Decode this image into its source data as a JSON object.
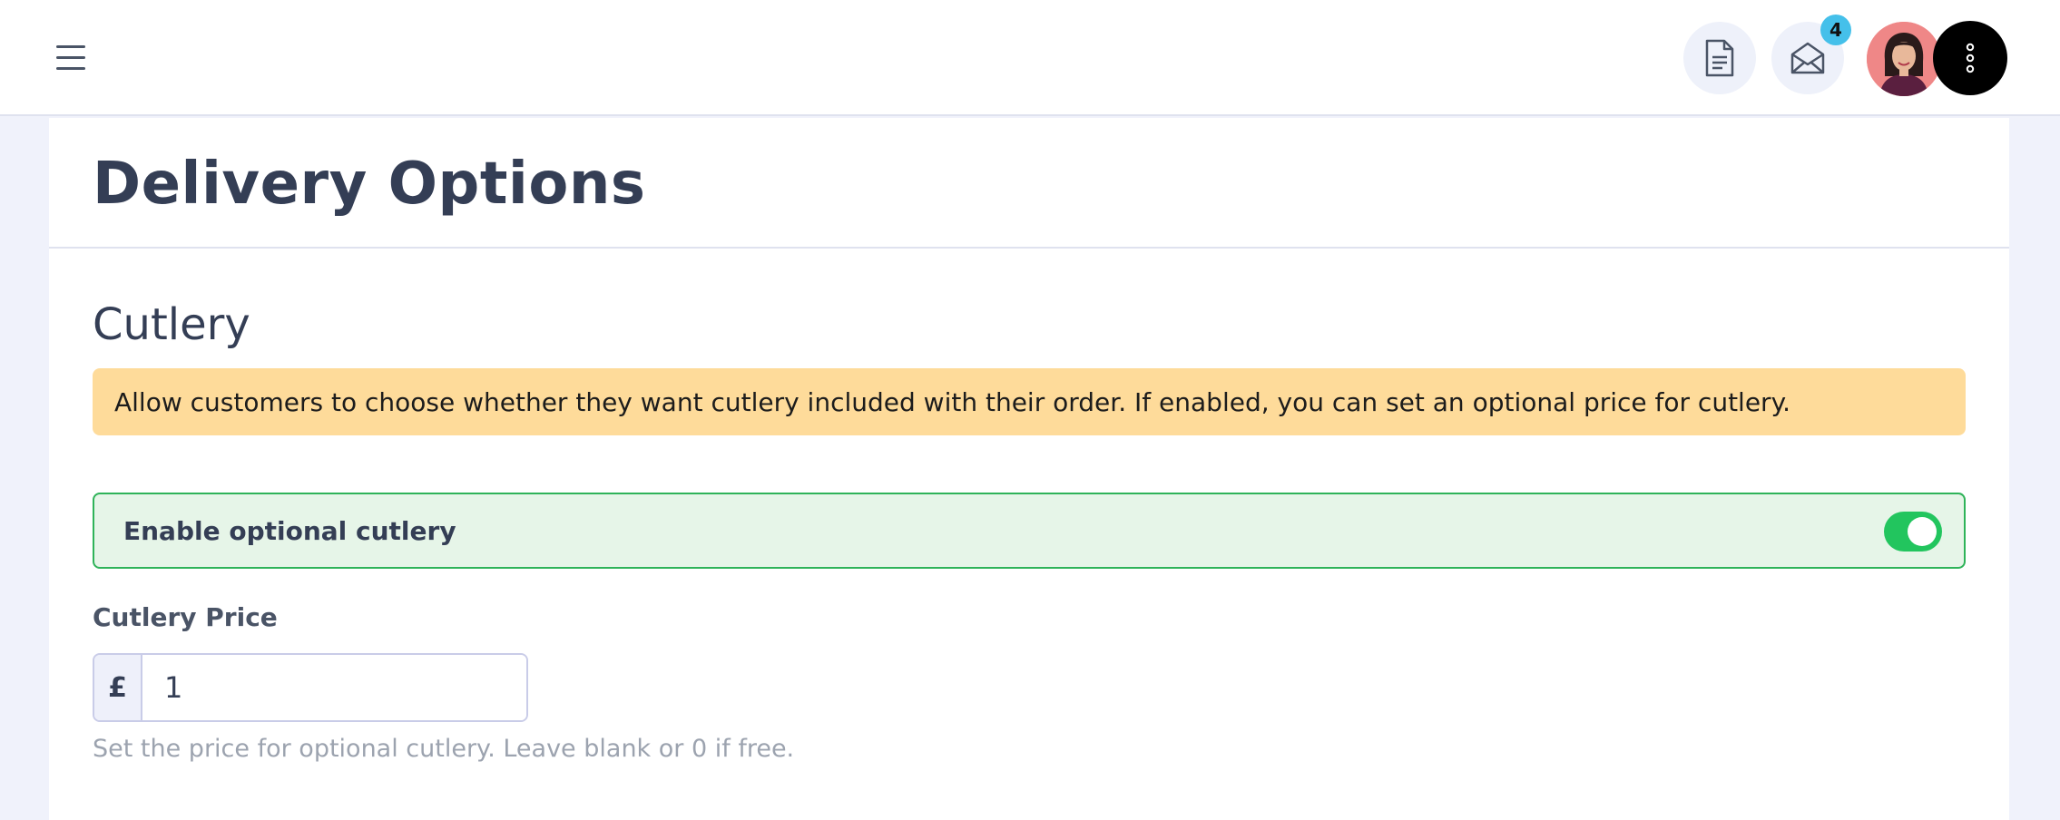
{
  "header": {
    "menu_icon": "hamburger-icon",
    "docs_icon": "document-icon",
    "mail_icon": "envelope-open-icon",
    "mail_badge": "4",
    "avatar_icon": "user-avatar",
    "more_icon": "vertical-ellipsis-icon"
  },
  "page": {
    "title": "Delivery Options"
  },
  "cutlery": {
    "section_title": "Cutlery",
    "info_text": "Allow customers to choose whether they want cutlery included with their order. If enabled, you can set an optional price for cutlery.",
    "toggle_label": "Enable optional cutlery",
    "toggle_on": true,
    "price_label": "Cutlery Price",
    "currency_symbol": "£",
    "price_value": "1",
    "help_text": "Set the price for optional cutlery. Leave blank or 0 if free."
  },
  "colors": {
    "accent_green": "#22c55e",
    "info_bg": "#fedb9a",
    "badge_bg": "#45c0ea",
    "text_primary": "#343e55"
  }
}
